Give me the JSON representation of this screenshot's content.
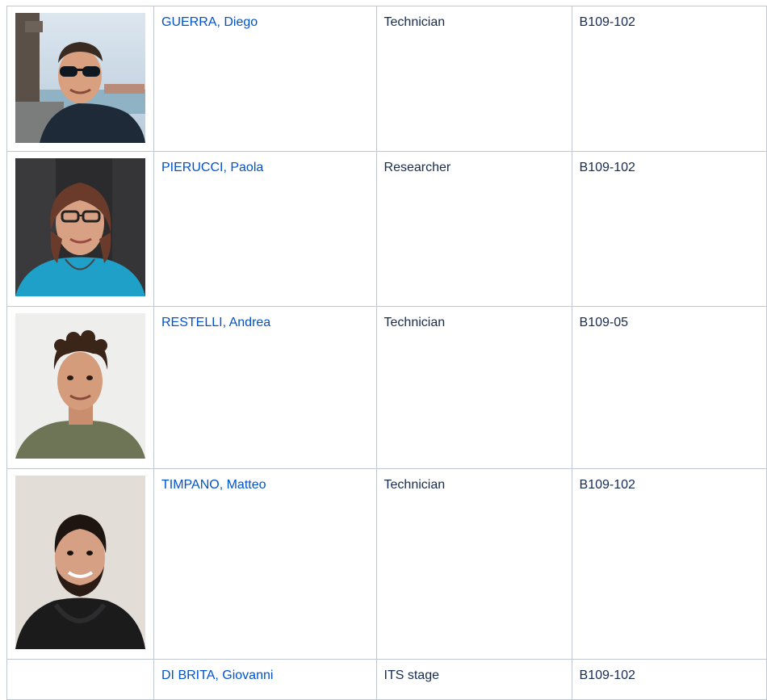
{
  "people": [
    {
      "name": "GUERRA, Diego",
      "role": "Technician",
      "room": "B109-102",
      "photo": "portrait-photo"
    },
    {
      "name": "PIERUCCI, Paola",
      "role": "Researcher",
      "room": "B109-102",
      "photo": "portrait-photo"
    },
    {
      "name": "RESTELLI, Andrea",
      "role": "Technician",
      "room": "B109-05",
      "photo": "portrait-photo"
    },
    {
      "name": "TIMPANO, Matteo",
      "role": "Technician",
      "room": "B109-102",
      "photo": "portrait-photo"
    },
    {
      "name": "DI BRITA, Giovanni",
      "role": "ITS stage",
      "room": "B109-102",
      "photo": ""
    }
  ],
  "colors": {
    "link": "#0052cc",
    "text": "#172b4d",
    "border": "#c1c7d0"
  }
}
